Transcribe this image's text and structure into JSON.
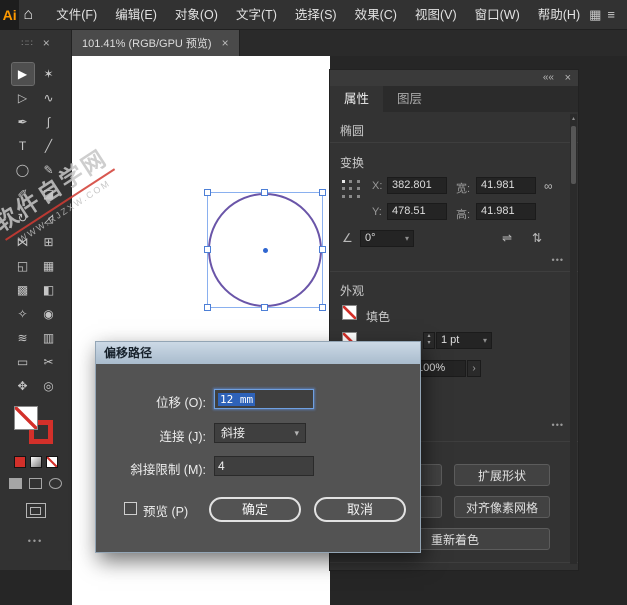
{
  "ui": {
    "caret_down": "▾",
    "caret_up": "▴",
    "chevron_right": "›",
    "more": "•••",
    "grip": "∷∷",
    "close": "×"
  },
  "colors": {
    "accent": "#3f7de0",
    "selection-blue": "#2e62b8",
    "circle-stroke": "#6a55a8",
    "swatch-red": "#d3302a",
    "watermark-red": "#d23b32"
  },
  "menubar": {
    "logo": "Ai",
    "home_icon": "⌂",
    "workspace_icon": "▦",
    "panel_icon": "≡",
    "items": [
      "文件(F)",
      "编辑(E)",
      "对象(O)",
      "文字(T)",
      "选择(S)",
      "效果(C)",
      "视图(V)",
      "窗口(W)",
      "帮助(H)"
    ]
  },
  "tabbar": {
    "doc_tab": "101.41% (RGB/GPU 预览)"
  },
  "toolbar": {
    "tools": [
      {
        "name": "selection",
        "glyph": "▶"
      },
      {
        "name": "magic-wand",
        "glyph": "✶"
      },
      {
        "name": "direct-selection",
        "glyph": "▷"
      },
      {
        "name": "lasso",
        "glyph": "∿"
      },
      {
        "name": "pen",
        "glyph": "✒"
      },
      {
        "name": "curvature",
        "glyph": "∫"
      },
      {
        "name": "type",
        "glyph": "T"
      },
      {
        "name": "line-segment",
        "glyph": "╱"
      },
      {
        "name": "ellipse",
        "glyph": "◯"
      },
      {
        "name": "paintbrush",
        "glyph": "✎"
      },
      {
        "name": "shaper",
        "glyph": "✐"
      },
      {
        "name": "eraser",
        "glyph": "◪"
      },
      {
        "name": "rotate",
        "glyph": "↻"
      },
      {
        "name": "scale",
        "glyph": "◿"
      },
      {
        "name": "width",
        "glyph": "⋈"
      },
      {
        "name": "free-transform",
        "glyph": "⊞"
      },
      {
        "name": "shape-builder",
        "glyph": "◱"
      },
      {
        "name": "perspective-grid",
        "glyph": "▦"
      },
      {
        "name": "mesh",
        "glyph": "▩"
      },
      {
        "name": "gradient",
        "glyph": "◧"
      },
      {
        "name": "eyedropper",
        "glyph": "✧"
      },
      {
        "name": "blend",
        "glyph": "◉"
      },
      {
        "name": "symbol-sprayer",
        "glyph": "≋"
      },
      {
        "name": "column-graph",
        "glyph": "▥"
      },
      {
        "name": "artboard",
        "glyph": "▭"
      },
      {
        "name": "slice",
        "glyph": "✂"
      },
      {
        "name": "hand",
        "glyph": "✥"
      },
      {
        "name": "zoom",
        "glyph": "◎"
      }
    ]
  },
  "canvas": {
    "watermark_line1": "软件自学网",
    "watermark_line2": "WWW.RJZXW.COM"
  },
  "panel": {
    "collapse_icon": "««",
    "tabs": [
      "属性",
      "图层"
    ],
    "object_type": "椭圆",
    "transform": {
      "title": "变换",
      "x_label": "X:",
      "x_value": "382.801",
      "y_label": "Y:",
      "y_value": "478.51",
      "w_label": "宽:",
      "w_value": "41.981",
      "h_label": "高:",
      "h_value": "41.981",
      "angle_icon": "∠",
      "angle_value": "0°",
      "link_icon": "∞",
      "flip_h_icon": "⇌",
      "flip_v_icon": "⇅"
    },
    "appearance": {
      "title": "外观",
      "fill_label": "填色",
      "stroke_weight": "1 pt",
      "opacity_value": "100%"
    },
    "actions": {
      "expand_shape": "扩展形状",
      "align_pixel_grid": "对齐像素网格",
      "recolor": "重新着色"
    }
  },
  "dialog": {
    "title": "偏移路径",
    "offset_label": "位移 (O):",
    "offset_value": "12 mm",
    "join_label": "连接 (J):",
    "join_value": "斜接",
    "miter_label": "斜接限制 (M):",
    "miter_value": "4",
    "preview_label": "预览 (P)",
    "ok_label": "确定",
    "cancel_label": "取消"
  }
}
